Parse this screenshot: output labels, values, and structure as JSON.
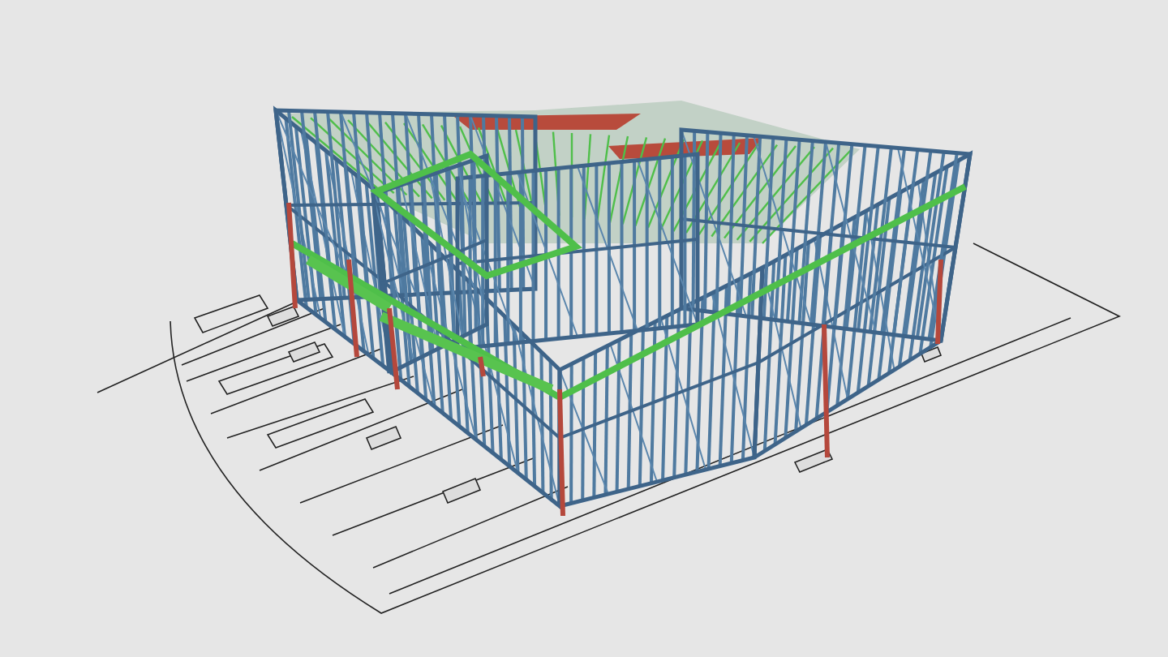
{
  "viewport": {
    "kind": "frame-model"
  }
}
